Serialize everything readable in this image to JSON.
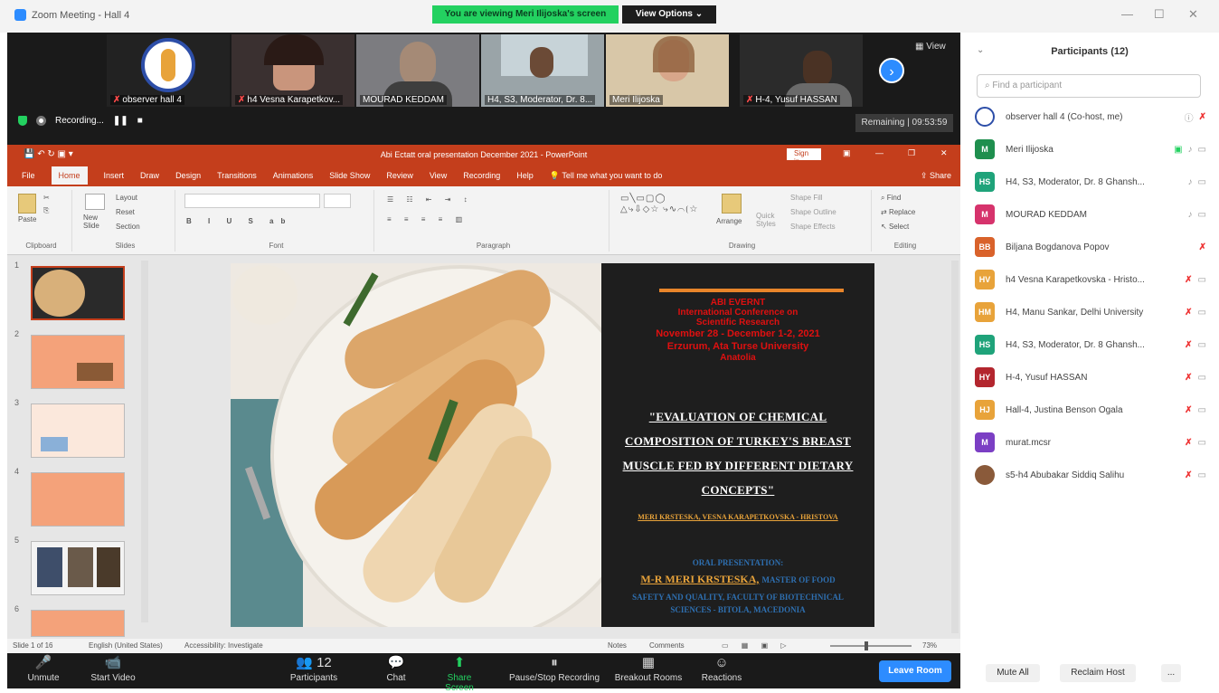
{
  "window": {
    "title": "Zoom Meeting - Hall 4",
    "min": "—",
    "max": "☐",
    "close": "✕"
  },
  "banner": "You are viewing Meri Ilijoska's screen",
  "view_options": "View Options ⌄",
  "video_tiles": [
    {
      "name": "observer hall 4"
    },
    {
      "name": "h4 Vesna Karapetkov..."
    },
    {
      "name": "MOURAD KEDDAM"
    },
    {
      "name": "H4, S3, Moderator, Dr. 8..."
    },
    {
      "name": "Meri Ilijoska"
    },
    {
      "name": "H-4, Yusuf HASSAN"
    }
  ],
  "view_label": "▦ View",
  "recording_label": "Recording...",
  "remaining": "Remaining | 09:53:59",
  "ppt": {
    "title": "Abi Ectatt oral presentation December 2021 - PowerPoint",
    "signin": "Sign in",
    "tabs": [
      "File",
      "Home",
      "Insert",
      "Draw",
      "Design",
      "Transitions",
      "Animations",
      "Slide Show",
      "Review",
      "View",
      "Recording",
      "Help",
      "Tell me what you want to do"
    ],
    "share": "Share",
    "groups": {
      "clipboard": "Clipboard",
      "slides": "Slides",
      "font": "Font",
      "paragraph": "Paragraph",
      "drawing": "Drawing",
      "editing": "Editing"
    },
    "ribbon_items": {
      "paste": "Paste",
      "new_slide": "New Slide",
      "layout": "Layout",
      "reset": "Reset",
      "section": "Section",
      "arrange": "Arrange",
      "quick_styles": "Quick Styles",
      "shape_fill": "Shape Fill",
      "shape_outline": "Shape Outline",
      "shape_effects": "Shape Effects",
      "find": "Find",
      "replace": "Replace",
      "select": "Select"
    },
    "thumb_numbers": [
      "1",
      "2",
      "3",
      "4",
      "5",
      "6"
    ],
    "status_left": "Slide 1 of 16",
    "status_lang": "English (United States)",
    "status_access": "Accessibility: Investigate",
    "status_notes": "Notes",
    "status_comments": "Comments",
    "zoom": "73%"
  },
  "slide": {
    "conf_lines": [
      "ABI EVERNT",
      "International Conference on",
      "Scientific Research",
      "November 28 - December 1-2, 2021",
      "Erzurum, Ata Turse University",
      "Anatolia"
    ],
    "title_lines": [
      "\"EVALUATION OF CHEMICAL",
      "COMPOSITION OF TURKEY'S BREAST",
      "MUSCLE FED BY DIFFERENT DIETARY",
      "CONCEPTS\""
    ],
    "authors": "MERI KRSTESKA, VESNA KARAPETKOVSKA - HRISTOVA",
    "oral": "ORAL PRESENTATION:",
    "presenter": "M-R MERI KRSTESKA,",
    "presenter_rest": "MASTER OF FOOD",
    "affil1": "SAFETY AND QUALITY, FACULTY OF BIOTECHNICAL",
    "affil2": "SCIENCES - BITOLA, MACEDONIA"
  },
  "controls": [
    {
      "label": "Unmute",
      "icon": "🎤"
    },
    {
      "label": "Start Video",
      "icon": "📹"
    },
    {
      "label": "Participants",
      "icon": "👥 12"
    },
    {
      "label": "Chat",
      "icon": "💬"
    },
    {
      "label": "Share Screen",
      "icon": "⬆"
    },
    {
      "label": "Pause/Stop Recording",
      "icon": "⏸"
    },
    {
      "label": "Breakout Rooms",
      "icon": "▦"
    },
    {
      "label": "Reactions",
      "icon": "☺"
    }
  ],
  "leave": "Leave Room",
  "panel": {
    "title": "Participants (12)",
    "search_placeholder": "Find a participant",
    "participants": [
      {
        "initials": "",
        "name": "observer hall 4 (Co-host, me)",
        "color": "#8a7c3a"
      },
      {
        "initials": "M",
        "name": "Meri Ilijoska",
        "color": "#1f8f4e"
      },
      {
        "initials": "HS",
        "name": "H4, S3, Moderator, Dr. 8 Ghansh...",
        "color": "#1fa37a"
      },
      {
        "initials": "M",
        "name": "MOURAD KEDDAM",
        "color": "#d6336c"
      },
      {
        "initials": "BB",
        "name": "Biljana Bogdanova Popov",
        "color": "#d9622b"
      },
      {
        "initials": "HV",
        "name": "h4 Vesna Karapetkovska - Hristo...",
        "color": "#e8a33a"
      },
      {
        "initials": "HM",
        "name": "H4, Manu Sankar, Delhi University",
        "color": "#e8a33a"
      },
      {
        "initials": "HS",
        "name": "H4, S3, Moderator, Dr. 8 Ghansh...",
        "color": "#1fa37a"
      },
      {
        "initials": "HY",
        "name": "H-4, Yusuf HASSAN",
        "color": "#b3262e"
      },
      {
        "initials": "HJ",
        "name": "Hall-4, Justina Benson Ogala",
        "color": "#e8a33a"
      },
      {
        "initials": "M",
        "name": "murat.mcsr",
        "color": "#7b3fc4"
      },
      {
        "initials": "",
        "name": "s5-h4 Abubakar Siddiq Salihu",
        "color": "#8a5a3a"
      }
    ],
    "mute_all": "Mute All",
    "reclaim": "Reclaim Host",
    "more": "..."
  }
}
